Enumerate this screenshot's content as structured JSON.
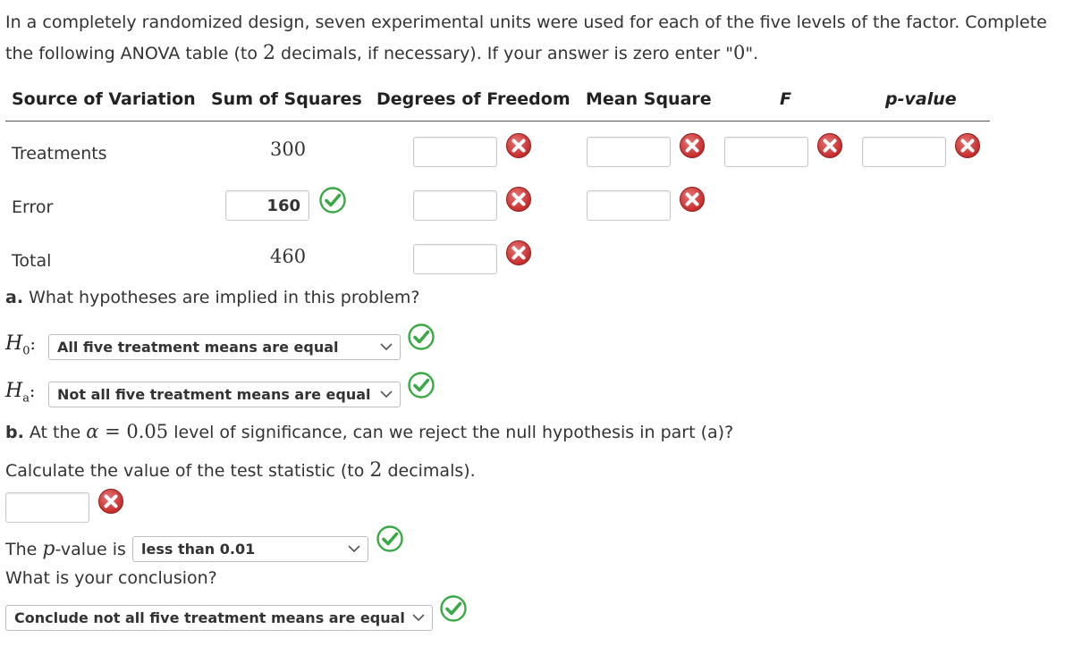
{
  "intro": {
    "line1": "In a completely randomized design, seven experimental units were used for each of the five levels of the factor. Complete",
    "line2_pre": "the following ANOVA table (to ",
    "line2_num": "2",
    "line2_mid": " decimals, if necessary). If your answer is zero enter \"",
    "line2_zero": "0",
    "line2_post": "\"."
  },
  "table": {
    "headers": {
      "source": "Source of Variation",
      "ss": "Sum of Squares",
      "df": "Degrees of Freedom",
      "ms": "Mean Square",
      "f": "F",
      "p": "p-value"
    },
    "rows": [
      {
        "label": "Treatments",
        "ss": "300"
      },
      {
        "label": "Error",
        "ss": "160"
      },
      {
        "label": "Total",
        "ss": "460"
      }
    ]
  },
  "part_a": {
    "question": "What hypotheses are implied in this problem?",
    "label": "a.",
    "h0_symbol": "H",
    "h0_sub": "0",
    "h0_value": "All five treatment means are equal",
    "ha_symbol": "H",
    "ha_sub": "a",
    "ha_value": "Not all five treatment means are equal"
  },
  "part_b": {
    "label": "b.",
    "q_pre": "At the ",
    "alpha_symbol": "α",
    "alpha_eq": " = ",
    "alpha_value": "0.05",
    "q_post": " level of significance, can we reject the null hypothesis in part (a)?",
    "calc_pre": "Calculate the value of the test statistic (to ",
    "calc_num": "2",
    "calc_post": " decimals).",
    "pvalue_pre": "The ",
    "pvalue_symbol": "p",
    "pvalue_post": "-value is",
    "pvalue_selection": "less than 0.01",
    "conclusion_question": "What is your conclusion?",
    "conclusion_selection": "Conclude not all five treatment means are equal"
  },
  "colors": {
    "incorrect": "#c62828",
    "correct": "#3aa845"
  },
  "icons": {
    "incorrect": "x-circle-icon",
    "correct": "check-circle-icon",
    "dropdown": "chevron-down-icon"
  }
}
